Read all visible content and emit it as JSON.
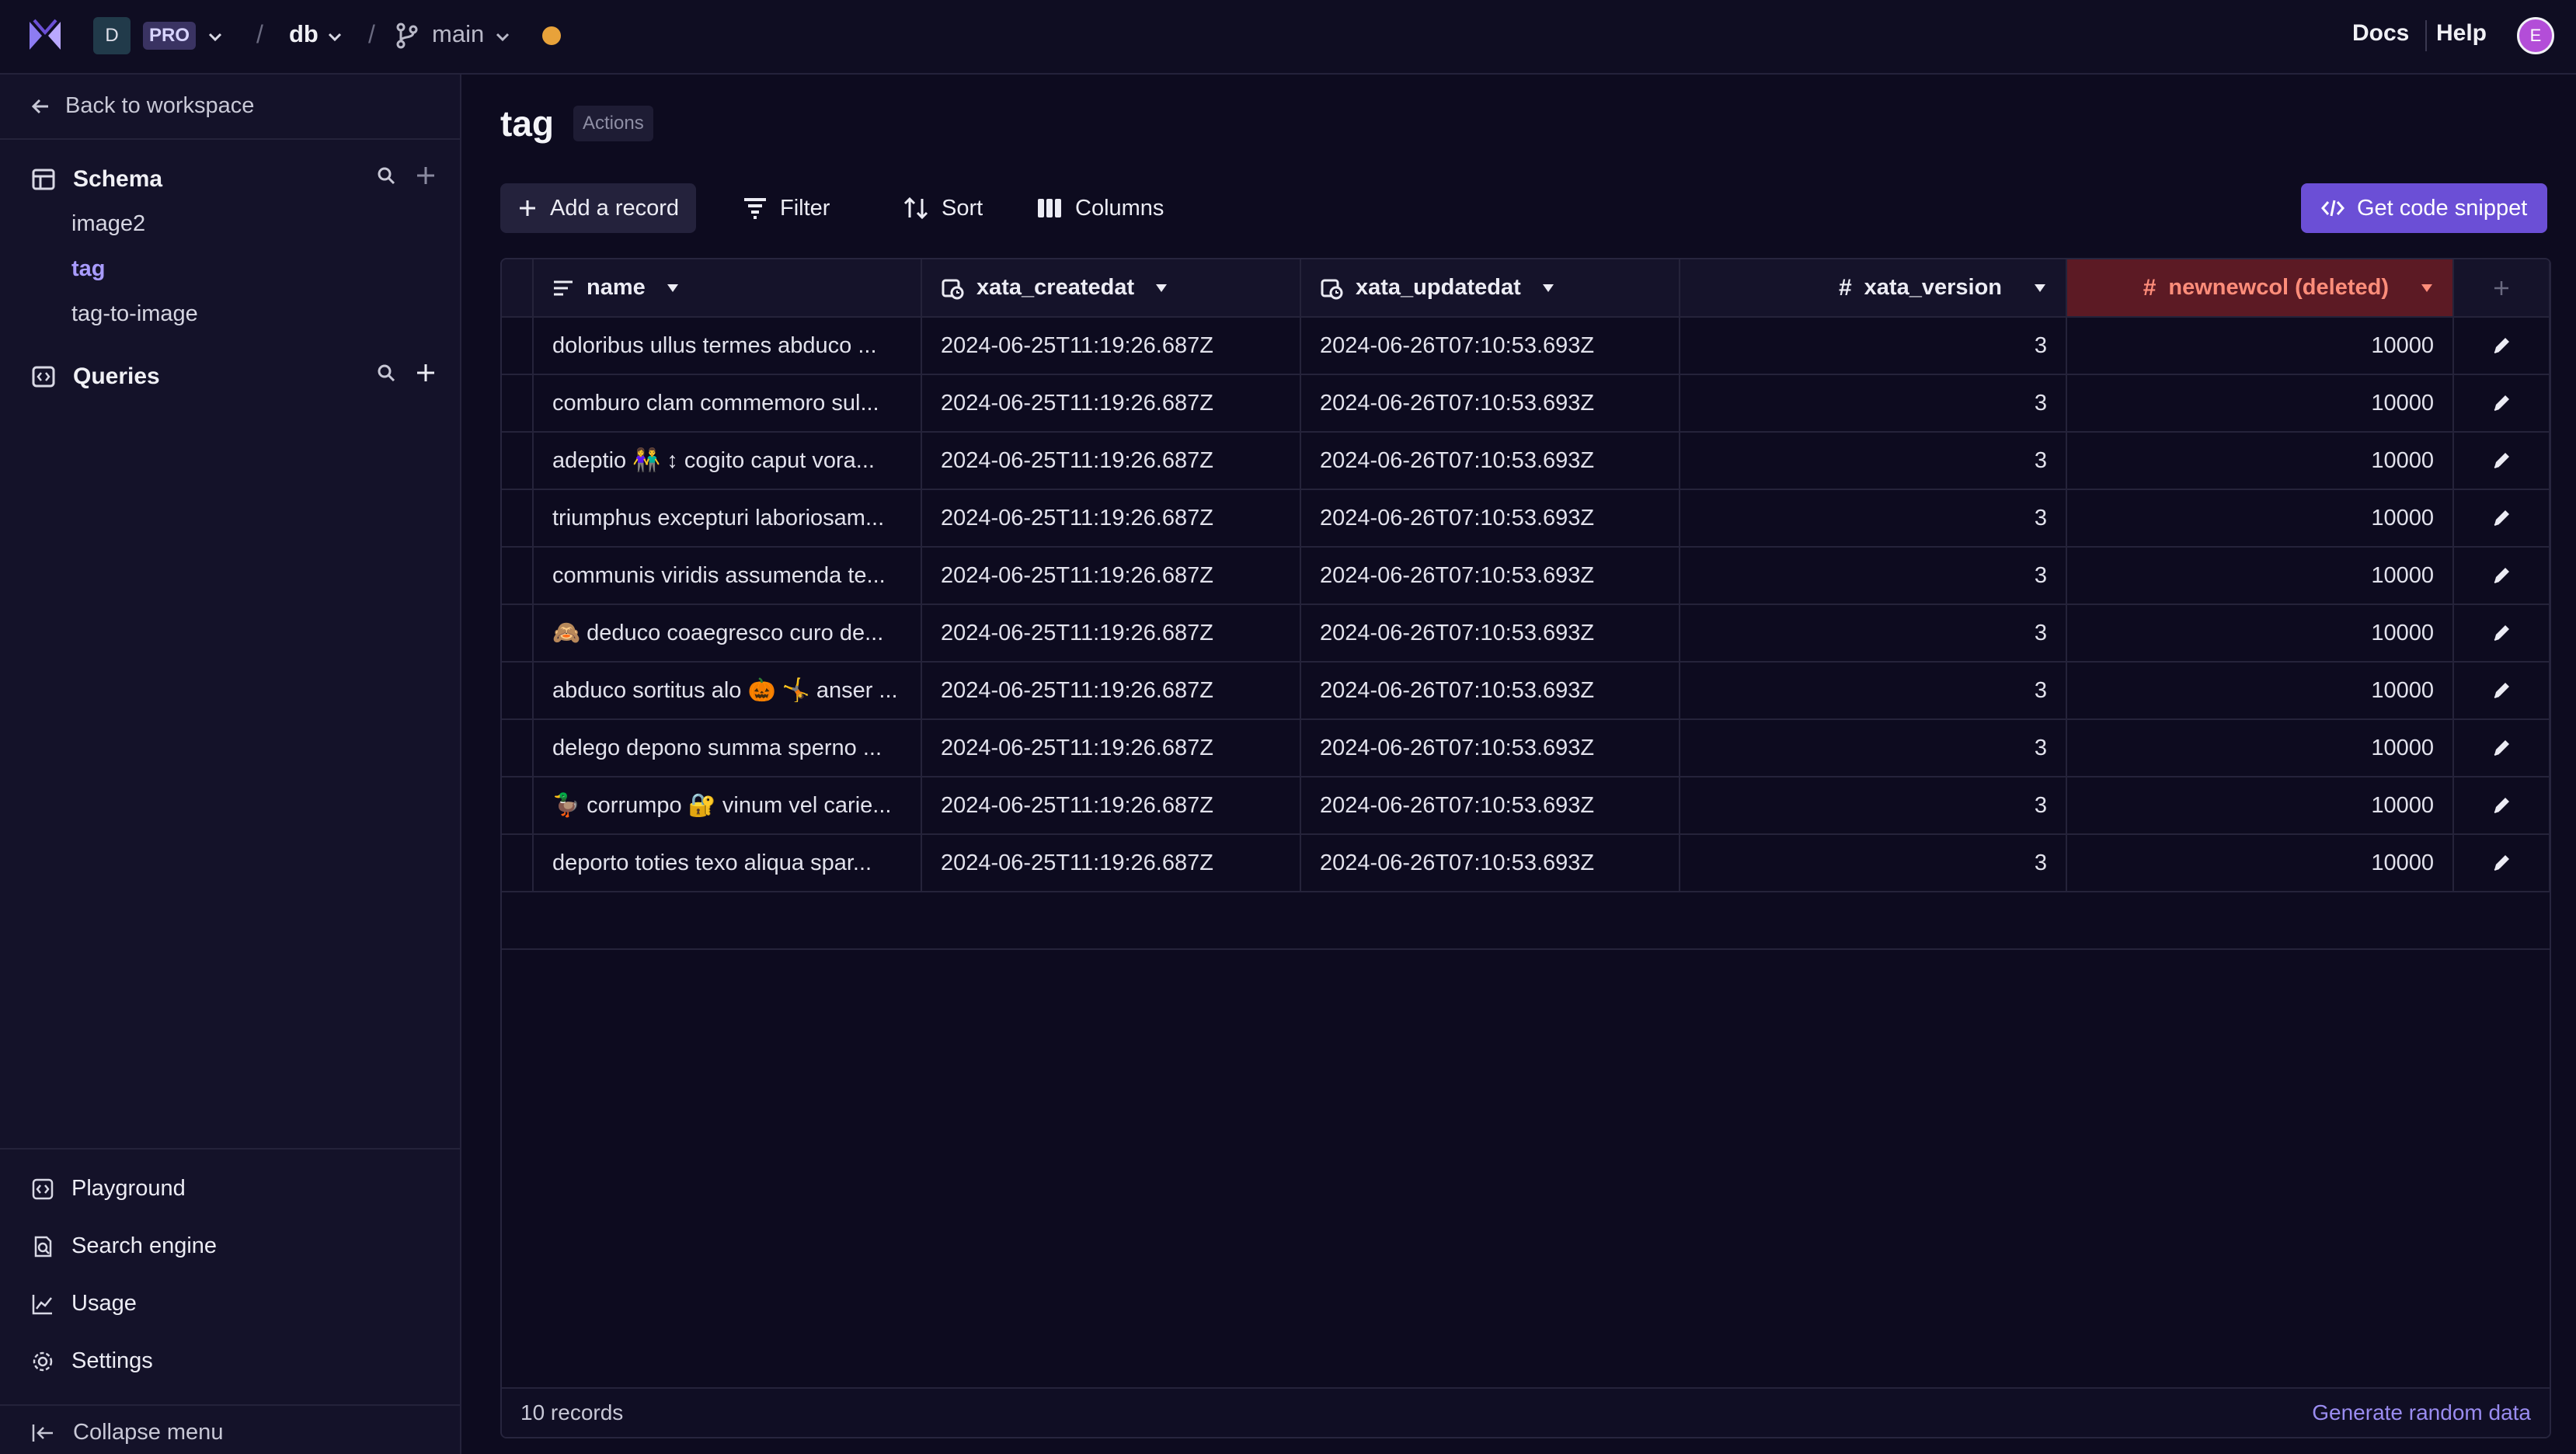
{
  "header": {
    "workspace_initial": "D",
    "plan_badge": "PRO",
    "database": "db",
    "branch": "main",
    "docs_label": "Docs",
    "help_label": "Help",
    "user_initial": "E"
  },
  "sidebar": {
    "back_label": "Back to workspace",
    "schema_label": "Schema",
    "tables": [
      "image2",
      "tag",
      "tag-to-image"
    ],
    "active_table": "tag",
    "queries_label": "Queries",
    "bottom_items": [
      "Playground",
      "Search engine",
      "Usage",
      "Settings"
    ],
    "collapse_label": "Collapse menu"
  },
  "main": {
    "title": "tag",
    "actions_label": "Actions",
    "toolbar": {
      "add_record": "Add a record",
      "filter": "Filter",
      "sort": "Sort",
      "columns": "Columns",
      "code_snippet": "Get code snippet"
    },
    "table": {
      "columns": [
        {
          "label": "name",
          "icon": "text-icon"
        },
        {
          "label": "xata_createdat",
          "icon": "datetime-icon"
        },
        {
          "label": "xata_updatedat",
          "icon": "datetime-icon"
        },
        {
          "label": "xata_version",
          "icon": "hash-icon"
        },
        {
          "label": "newnewcol (deleted)",
          "icon": "hash-icon"
        }
      ],
      "rows": [
        {
          "name": "doloribus ullus termes abduco ...",
          "created": "2024-06-25T11:19:26.687Z",
          "updated": "2024-06-26T07:10:53.693Z",
          "version": "3",
          "newcol": "10000"
        },
        {
          "name": "comburo clam commemoro sul...",
          "created": "2024-06-25T11:19:26.687Z",
          "updated": "2024-06-26T07:10:53.693Z",
          "version": "3",
          "newcol": "10000"
        },
        {
          "name": "adeptio 👫 ↕ cogito caput vora...",
          "created": "2024-06-25T11:19:26.687Z",
          "updated": "2024-06-26T07:10:53.693Z",
          "version": "3",
          "newcol": "10000"
        },
        {
          "name": "triumphus excepturi laboriosam...",
          "created": "2024-06-25T11:19:26.687Z",
          "updated": "2024-06-26T07:10:53.693Z",
          "version": "3",
          "newcol": "10000"
        },
        {
          "name": "communis viridis assumenda te...",
          "created": "2024-06-25T11:19:26.687Z",
          "updated": "2024-06-26T07:10:53.693Z",
          "version": "3",
          "newcol": "10000"
        },
        {
          "name": "🙈 deduco coaegresco curo de...",
          "created": "2024-06-25T11:19:26.687Z",
          "updated": "2024-06-26T07:10:53.693Z",
          "version": "3",
          "newcol": "10000"
        },
        {
          "name": "abduco sortitus alo 🎃 🤸 anser ...",
          "created": "2024-06-25T11:19:26.687Z",
          "updated": "2024-06-26T07:10:53.693Z",
          "version": "3",
          "newcol": "10000"
        },
        {
          "name": "delego depono summa sperno ...",
          "created": "2024-06-25T11:19:26.687Z",
          "updated": "2024-06-26T07:10:53.693Z",
          "version": "3",
          "newcol": "10000"
        },
        {
          "name": "🦆 corrumpo 🔐 vinum vel carie...",
          "created": "2024-06-25T11:19:26.687Z",
          "updated": "2024-06-26T07:10:53.693Z",
          "version": "3",
          "newcol": "10000"
        },
        {
          "name": "deporto toties texo aliqua spar...",
          "created": "2024-06-25T11:19:26.687Z",
          "updated": "2024-06-26T07:10:53.693Z",
          "version": "3",
          "newcol": "10000"
        }
      ]
    },
    "footer": {
      "records": "10 records",
      "generate": "Generate random data"
    }
  },
  "colors": {
    "accent": "#6b4fd6",
    "active_link": "#a99cff",
    "deleted_header_bg": "#5c1a24",
    "deleted_header_text": "#ff8d7a"
  }
}
